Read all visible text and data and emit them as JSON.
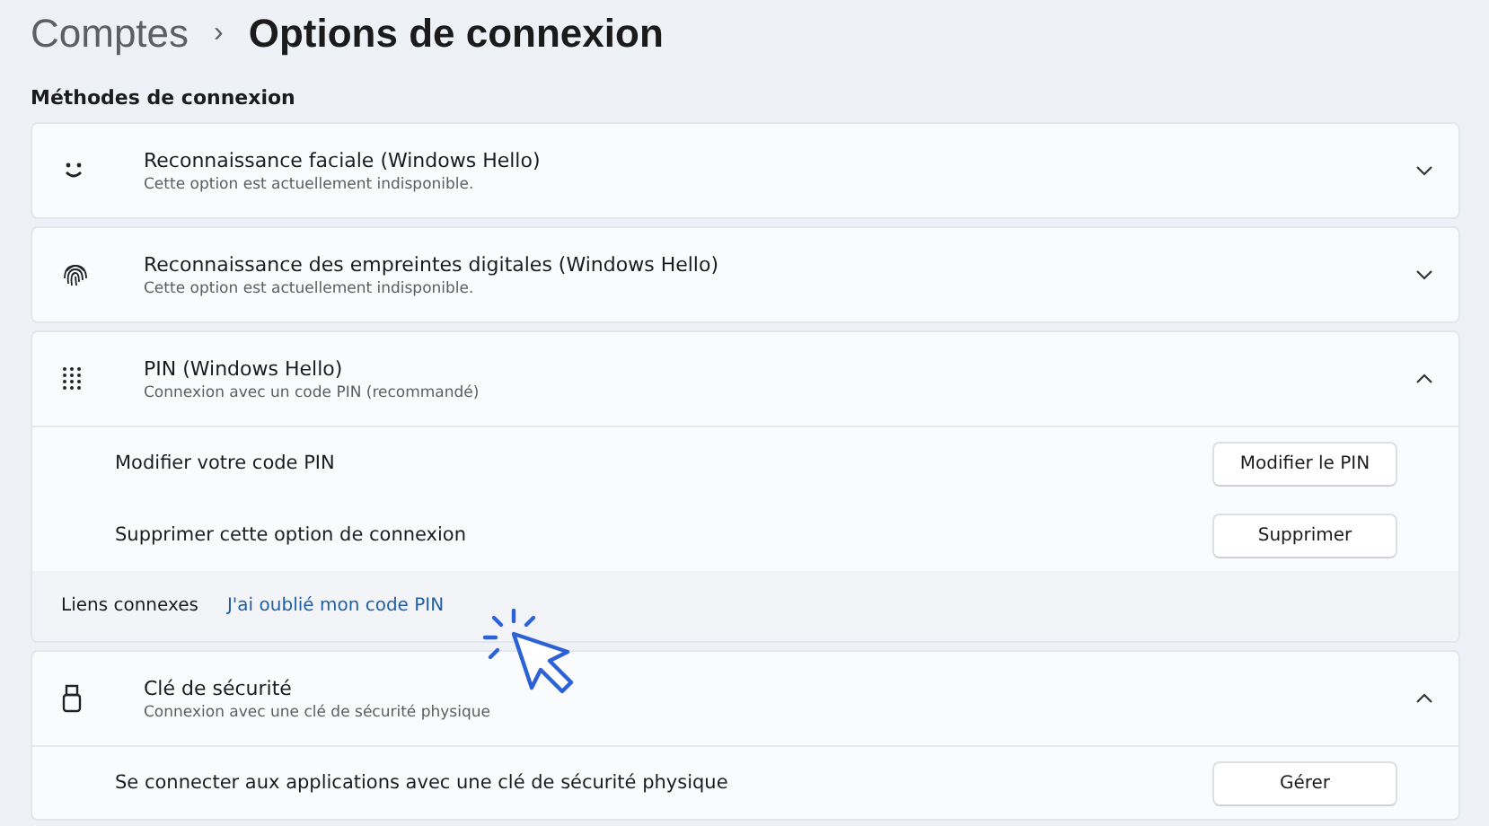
{
  "breadcrumb": {
    "parent": "Comptes",
    "separator": "›",
    "current": "Options de connexion"
  },
  "section_title": "Méthodes de connexion",
  "methods": [
    {
      "kind": "face",
      "title": "Reconnaissance faciale (Windows Hello)",
      "subtitle": "Cette option est actuellement indisponible.",
      "expanded": false
    },
    {
      "kind": "fingerprint",
      "title": "Reconnaissance des empreintes digitales (Windows Hello)",
      "subtitle": "Cette option est actuellement indisponible.",
      "expanded": false
    },
    {
      "kind": "keypad",
      "title": "PIN (Windows Hello)",
      "subtitle": "Connexion avec un code PIN (recommandé)",
      "expanded": true,
      "rows": [
        {
          "kind": "setting",
          "label": "Modifier votre code PIN",
          "button": "Modifier le PIN"
        },
        {
          "kind": "setting",
          "label": "Supprimer cette option de connexion",
          "button": "Supprimer"
        },
        {
          "kind": "related",
          "label": "Liens connexes",
          "link": "J'ai oublié mon code PIN"
        }
      ]
    },
    {
      "kind": "key",
      "title": "Clé de sécurité",
      "subtitle": "Connexion avec une clé de sécurité physique",
      "expanded": true,
      "rows": [
        {
          "kind": "setting",
          "label": "Se connecter aux applications avec une clé de sécurité physique",
          "button": "Gérer"
        }
      ]
    }
  ]
}
